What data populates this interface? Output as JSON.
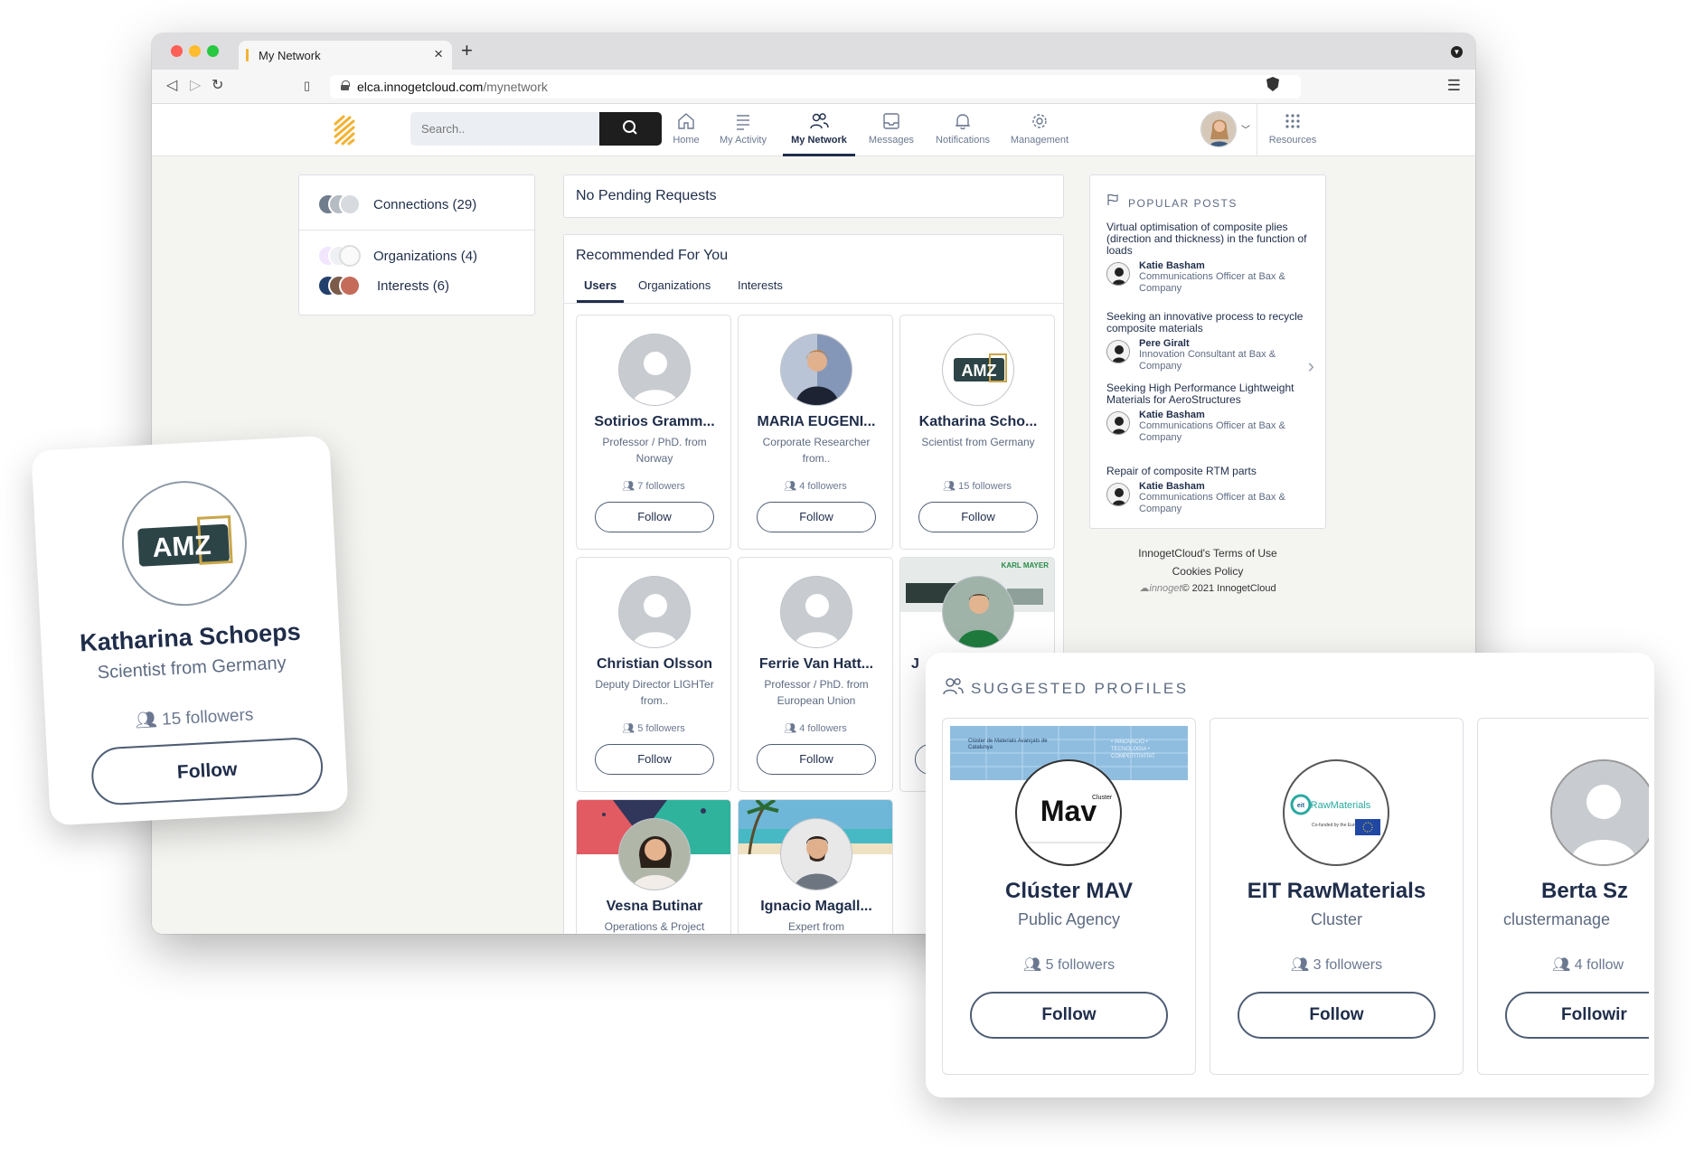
{
  "browser": {
    "tab_title": "My Network",
    "tab_close": "×",
    "new_tab": "+",
    "url_domain": "elca.innogetcloud.com",
    "url_path": "/mynetwork"
  },
  "header": {
    "search_placeholder": "Search..",
    "nav": [
      {
        "label": "Home",
        "icon": "home-icon"
      },
      {
        "label": "My Activity",
        "icon": "list-icon"
      },
      {
        "label": "My Network",
        "icon": "users-icon"
      },
      {
        "label": "Messages",
        "icon": "inbox-icon"
      },
      {
        "label": "Notifications",
        "icon": "bell-icon"
      },
      {
        "label": "Management",
        "icon": "gear-icon"
      },
      {
        "label": "Resources",
        "icon": "grid-icon"
      }
    ],
    "active_nav": "My Network"
  },
  "left_panel": {
    "connections": "Connections (29)",
    "organizations": "Organizations (4)",
    "interests": "Interests (6)"
  },
  "pending": {
    "text": "No Pending Requests"
  },
  "recommended": {
    "title": "Recommended For You",
    "tabs": [
      "Users",
      "Organizations",
      "Interests"
    ],
    "active_tab": "Users",
    "users": [
      {
        "name": "Sotirios Gramm...",
        "sub": "Professor / PhD. from Norway",
        "followers": "7 followers",
        "follow": "Follow"
      },
      {
        "name": "MARIA EUGENI...",
        "sub": "Corporate Researcher from..",
        "followers": "4 followers",
        "follow": "Follow"
      },
      {
        "name": "Katharina Scho...",
        "sub": "Scientist from Germany",
        "followers": "15 followers",
        "follow": "Follow"
      },
      {
        "name": "Christian Olsson",
        "sub": "Deputy Director LIGHTer from..",
        "followers": "5 followers",
        "follow": "Follow"
      },
      {
        "name": "Ferrie Van Hatt...",
        "sub": "Professor / PhD. from European Union",
        "followers": "4 followers",
        "follow": "Follow"
      },
      {
        "name": "J",
        "sub": "",
        "followers": "",
        "follow": ""
      },
      {
        "name": "Vesna Butinar",
        "sub": "Operations & Project",
        "followers": "",
        "follow": ""
      },
      {
        "name": "Ignacio Magall...",
        "sub": "Expert from",
        "followers": "",
        "follow": ""
      }
    ],
    "banner_text": "KARL MAYER"
  },
  "popular_posts": {
    "title": "POPULAR POSTS",
    "posts": [
      {
        "title": "Virtual optimisation of composite plies (direction and thickness) in the function of loads",
        "author": "Katie Basham",
        "role": "Communications Officer at Bax & Company"
      },
      {
        "title": "Seeking an innovative process to recycle composite materials",
        "author": "Pere Giralt",
        "role": "Innovation Consultant at Bax & Company"
      },
      {
        "title": "Seeking High Performance Lightweight Materials for AeroStructures",
        "author": "Katie Basham",
        "role": "Communications Officer at Bax & Company"
      },
      {
        "title": "Repair of composite RTM parts",
        "author": "Katie Basham",
        "role": "Communications Officer at Bax & Company"
      }
    ]
  },
  "footer": {
    "terms": "InnogetCloud's Terms of Use",
    "cookies": "Cookies Policy",
    "copyright": "© 2021 InnogetCloud",
    "logo_word": "innoget"
  },
  "float_card": {
    "logo": "AMZ",
    "name": "Katharina Schoeps",
    "sub": "Scientist from Germany",
    "followers": "15 followers",
    "follow": "Follow"
  },
  "suggested": {
    "title": "SUGGESTED PROFILES",
    "profiles": [
      {
        "name": "Clúster MAV",
        "sub": "Public Agency",
        "followers": "5 followers",
        "follow": "Follow",
        "logo": "Mav",
        "logo_small": "Cluster",
        "banner_text": "Clúster de Materials Avançats de Catalunya",
        "banner_side": "• INNOVACIÓ • TECNOLOGIA • COMPETITIVITAT"
      },
      {
        "name": "EIT RawMaterials",
        "sub": "Cluster",
        "followers": "3 followers",
        "follow": "Follow",
        "logo": "RawMaterials",
        "logo_small": "Co-funded by the European Union"
      },
      {
        "name": "Berta Sz",
        "sub": "clustermanage",
        "followers": "4 follow",
        "follow": "Followir"
      }
    ]
  },
  "colors": {
    "accent": "#1f2d4a",
    "secondary_text": "#5d6b82",
    "logo_orange": "#f2b233"
  }
}
